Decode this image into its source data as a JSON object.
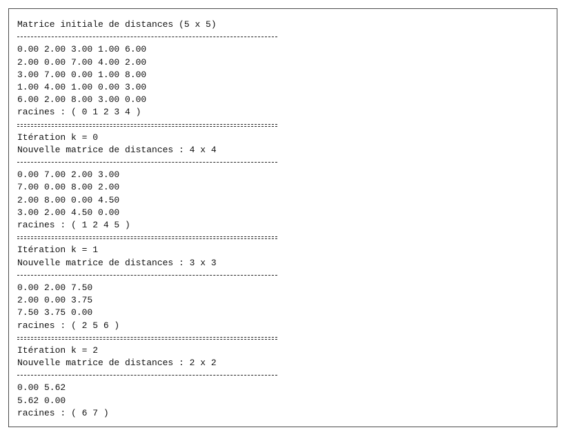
{
  "initial": {
    "title": "Matrice initiale de distances (5 x 5)",
    "rows": [
      "0.00 2.00 3.00 1.00 6.00",
      "2.00 0.00 7.00 4.00 2.00",
      "3.00 7.00 0.00 1.00 8.00",
      "1.00 4.00 1.00 0.00 3.00",
      "6.00 2.00 8.00 3.00 0.00"
    ],
    "roots": "racines : ( 0 1 2 3 4 )"
  },
  "iterations": [
    {
      "header": "Itération k = 0",
      "subheader": "Nouvelle matrice de distances : 4 x 4",
      "rows": [
        "0.00 7.00 2.00 3.00",
        "7.00 0.00 8.00 2.00",
        "2.00 8.00 0.00 4.50",
        "3.00 2.00 4.50 0.00"
      ],
      "roots": "racines : ( 1 2 4 5 )"
    },
    {
      "header": "Itération k = 1",
      "subheader": "Nouvelle matrice de distances : 3 x 3",
      "rows": [
        "0.00 2.00 7.50",
        "2.00 0.00 3.75",
        "7.50 3.75 0.00"
      ],
      "roots": "racines : ( 2 5 6 )"
    },
    {
      "header": "Itération k = 2",
      "subheader": "Nouvelle matrice de distances : 2 x 2",
      "rows": [
        "0.00 5.62",
        "5.62 0.00"
      ],
      "roots": "racines : ( 6 7 )"
    }
  ]
}
